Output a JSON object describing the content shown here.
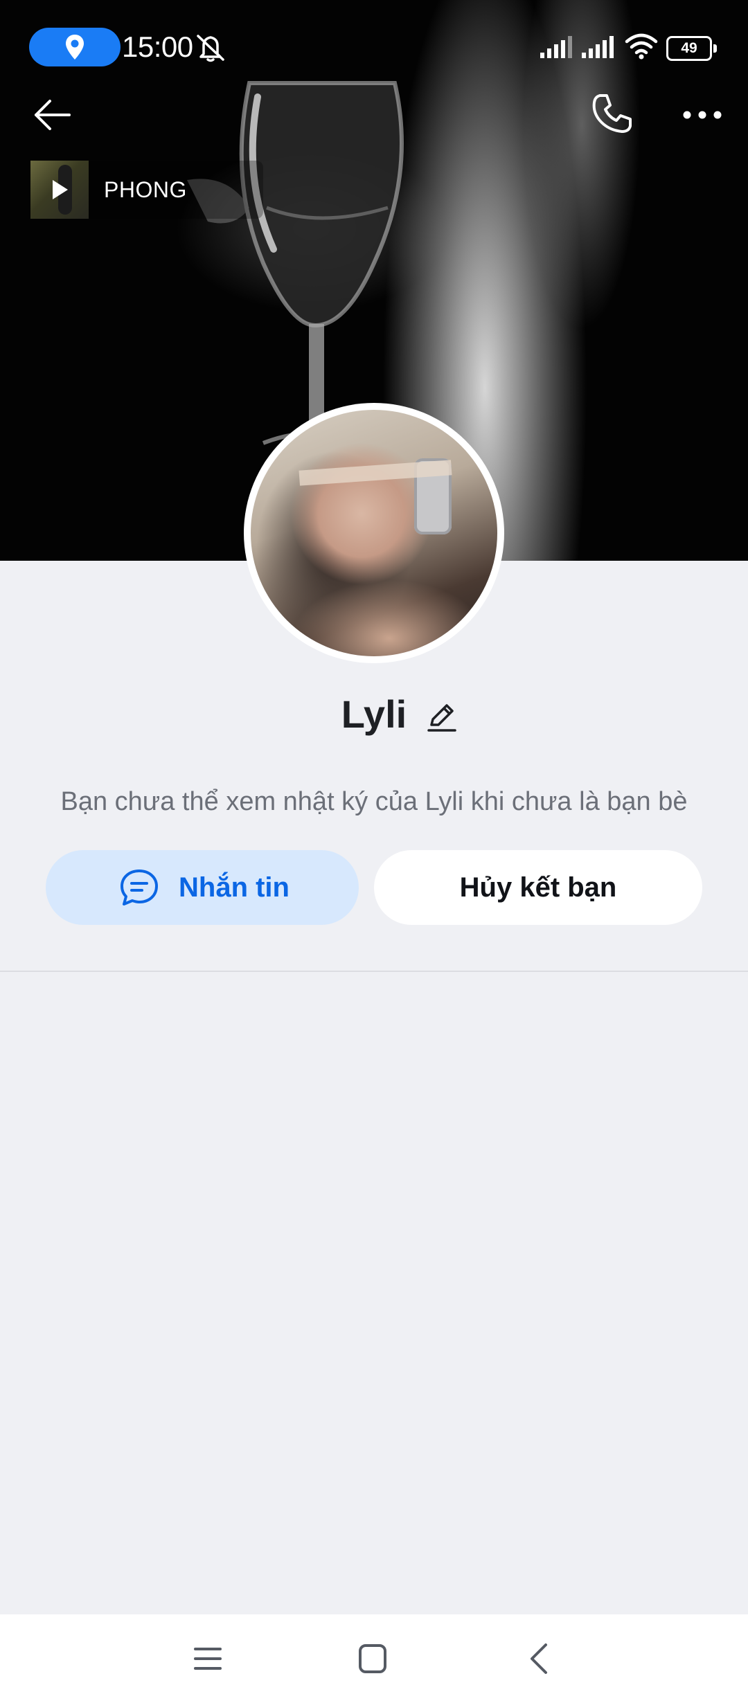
{
  "status_bar": {
    "time": "15:00",
    "battery": "49",
    "icons": [
      "location-icon",
      "mute-icon",
      "signal-icon",
      "signal-icon",
      "wifi-icon",
      "battery-icon"
    ]
  },
  "header": {
    "icons": [
      "back-arrow-icon",
      "phone-icon",
      "more-icon"
    ]
  },
  "music": {
    "title": "PHONG",
    "icon": "play-icon"
  },
  "profile": {
    "name": "Lyli",
    "edit_icon": "pencil-icon",
    "info": "Bạn chưa thể xem nhật ký của Lyli khi chưa là bạn bè"
  },
  "actions": {
    "message_label": "Nhắn tin",
    "message_icon": "chat-icon",
    "unfriend_label": "Hủy kết bạn"
  },
  "nav_bar": {
    "icons": [
      "menu-icon",
      "home-icon",
      "back-icon"
    ]
  },
  "colors": {
    "accent": "#0b66e4",
    "message_button_bg": "#d7e8fd",
    "page_bg": "#eff0f4",
    "location_pill": "#1a7cf5"
  }
}
